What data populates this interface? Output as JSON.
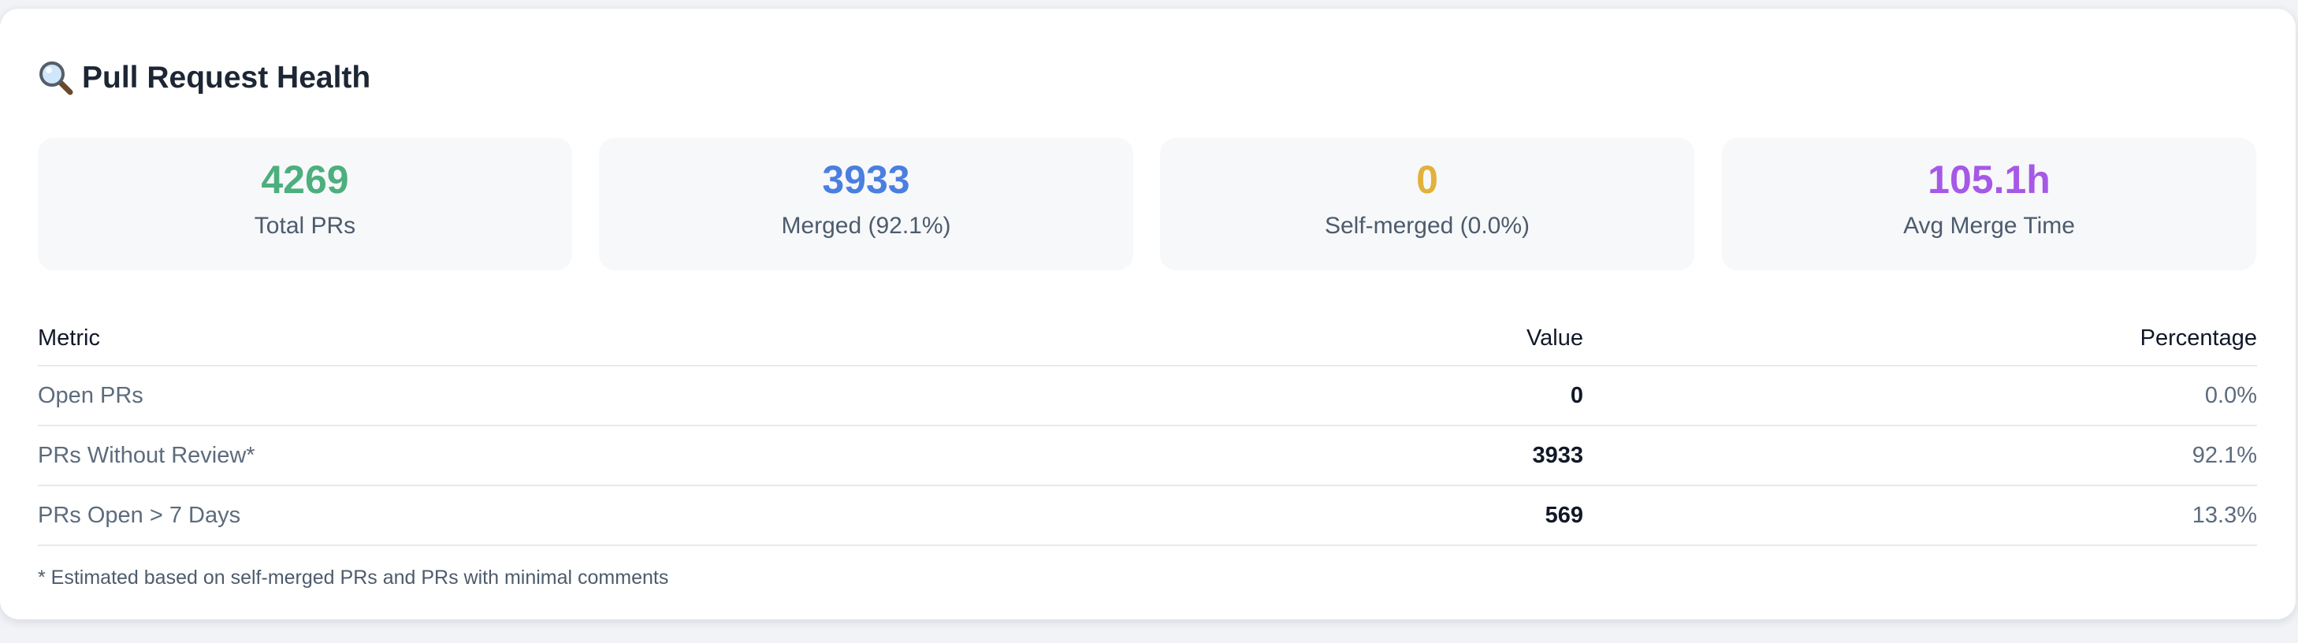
{
  "section": {
    "title": "Pull Request Health",
    "title_icon": "magnifier-icon"
  },
  "stats": [
    {
      "value": "4269",
      "label": "Total PRs",
      "color": "#4caf7d"
    },
    {
      "value": "3933",
      "label": "Merged (92.1%)",
      "color": "#4a7fe0"
    },
    {
      "value": "0",
      "label": "Self-merged (0.0%)",
      "color": "#e3b13b"
    },
    {
      "value": "105.1h",
      "label": "Avg Merge Time",
      "color": "#a559e6"
    }
  ],
  "table": {
    "headers": [
      "Metric",
      "Value",
      "Percentage"
    ],
    "rows": [
      {
        "metric": "Open PRs",
        "value": "0",
        "percentage": "0.0%"
      },
      {
        "metric": "PRs Without Review*",
        "value": "3933",
        "percentage": "92.1%"
      },
      {
        "metric": "PRs Open > 7 Days",
        "value": "569",
        "percentage": "13.3%"
      }
    ]
  },
  "footnote": "* Estimated based on self-merged PRs and PRs with minimal comments"
}
